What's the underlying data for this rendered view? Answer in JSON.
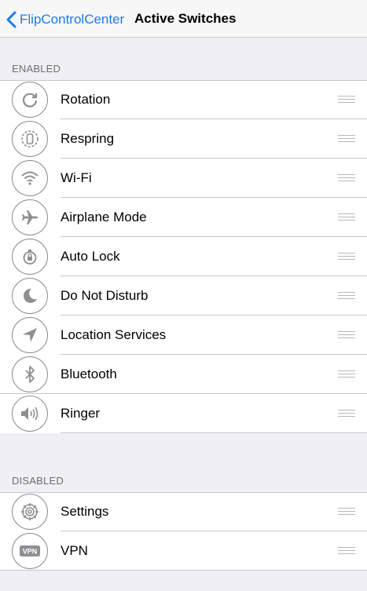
{
  "nav": {
    "back_label": "FlipControlCenter",
    "title": "Active Switches"
  },
  "enabled": {
    "header": "ENABLED",
    "items": [
      {
        "label": "Rotation",
        "icon": "rotation-icon"
      },
      {
        "label": "Respring",
        "icon": "respring-icon"
      },
      {
        "label": "Wi-Fi",
        "icon": "wifi-icon"
      },
      {
        "label": "Airplane Mode",
        "icon": "airplane-icon"
      },
      {
        "label": "Auto Lock",
        "icon": "auto-lock-icon"
      },
      {
        "label": "Do Not Disturb",
        "icon": "moon-icon"
      },
      {
        "label": "Location Services",
        "icon": "location-arrow-icon"
      },
      {
        "label": "Bluetooth",
        "icon": "bluetooth-icon"
      },
      {
        "label": "Ringer",
        "icon": "speaker-icon"
      }
    ]
  },
  "disabled": {
    "header": "DISABLED",
    "items": [
      {
        "label": "Settings",
        "icon": "gear-icon"
      },
      {
        "label": "VPN",
        "icon": "vpn-icon",
        "badge": "VPN"
      }
    ]
  },
  "colors": {
    "accent": "#1a7cf4",
    "background": "#efeff4",
    "separator": "#c8c7cc",
    "icon_stroke": "#8e8e93"
  }
}
